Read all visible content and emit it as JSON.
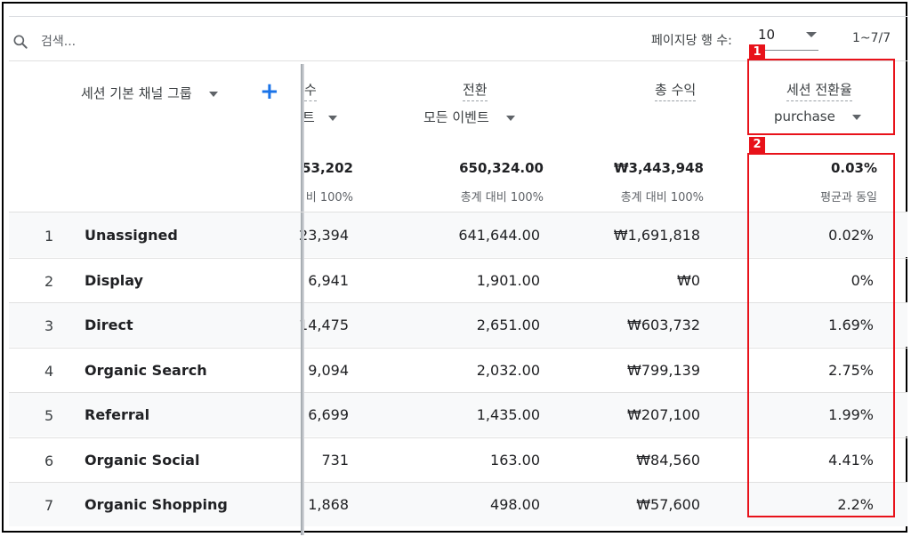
{
  "toolbar": {
    "search_placeholder": "검색...",
    "rows_per_page_label": "페이지당 행 수:",
    "rows_per_page_value": "10",
    "range": "1~7/7"
  },
  "header": {
    "dimension_label": "세션 기본 채널 그룹",
    "col1_title_partial": "수",
    "col1_sub_partial": "트",
    "col2_title": "전환",
    "col2_sub": "모든 이벤트",
    "col3_title": "총 수익",
    "col4_title": "세션 전환율",
    "col4_sub": "purchase"
  },
  "totals": {
    "col1": "53,202",
    "col1_sub": "비 100%",
    "col2": "650,324.00",
    "col2_sub": "총계 대비 100%",
    "col3": "₩3,443,948",
    "col3_sub": "총계 대비 100%",
    "col4": "0.03%",
    "col4_sub": "평균과 동일"
  },
  "rows": [
    {
      "idx": "1",
      "name": "Unassigned",
      "c1": "23,394",
      "c2": "641,644.00",
      "c3": "₩1,691,818",
      "c4": "0.02%"
    },
    {
      "idx": "2",
      "name": "Display",
      "c1": "6,941",
      "c2": "1,901.00",
      "c3": "₩0",
      "c4": "0%"
    },
    {
      "idx": "3",
      "name": "Direct",
      "c1": "14,475",
      "c2": "2,651.00",
      "c3": "₩603,732",
      "c4": "1.69%"
    },
    {
      "idx": "4",
      "name": "Organic Search",
      "c1": "9,094",
      "c2": "2,032.00",
      "c3": "₩799,139",
      "c4": "2.75%"
    },
    {
      "idx": "5",
      "name": "Referral",
      "c1": "6,699",
      "c2": "1,435.00",
      "c3": "₩207,100",
      "c4": "1.99%"
    },
    {
      "idx": "6",
      "name": "Organic Social",
      "c1": "731",
      "c2": "163.00",
      "c3": "₩84,560",
      "c4": "4.41%"
    },
    {
      "idx": "7",
      "name": "Organic Shopping",
      "c1": "1,868",
      "c2": "498.00",
      "c3": "₩57,600",
      "c4": "2.2%"
    }
  ],
  "annotations": {
    "label1": "1",
    "label2": "2",
    "color": "#e8121a"
  }
}
